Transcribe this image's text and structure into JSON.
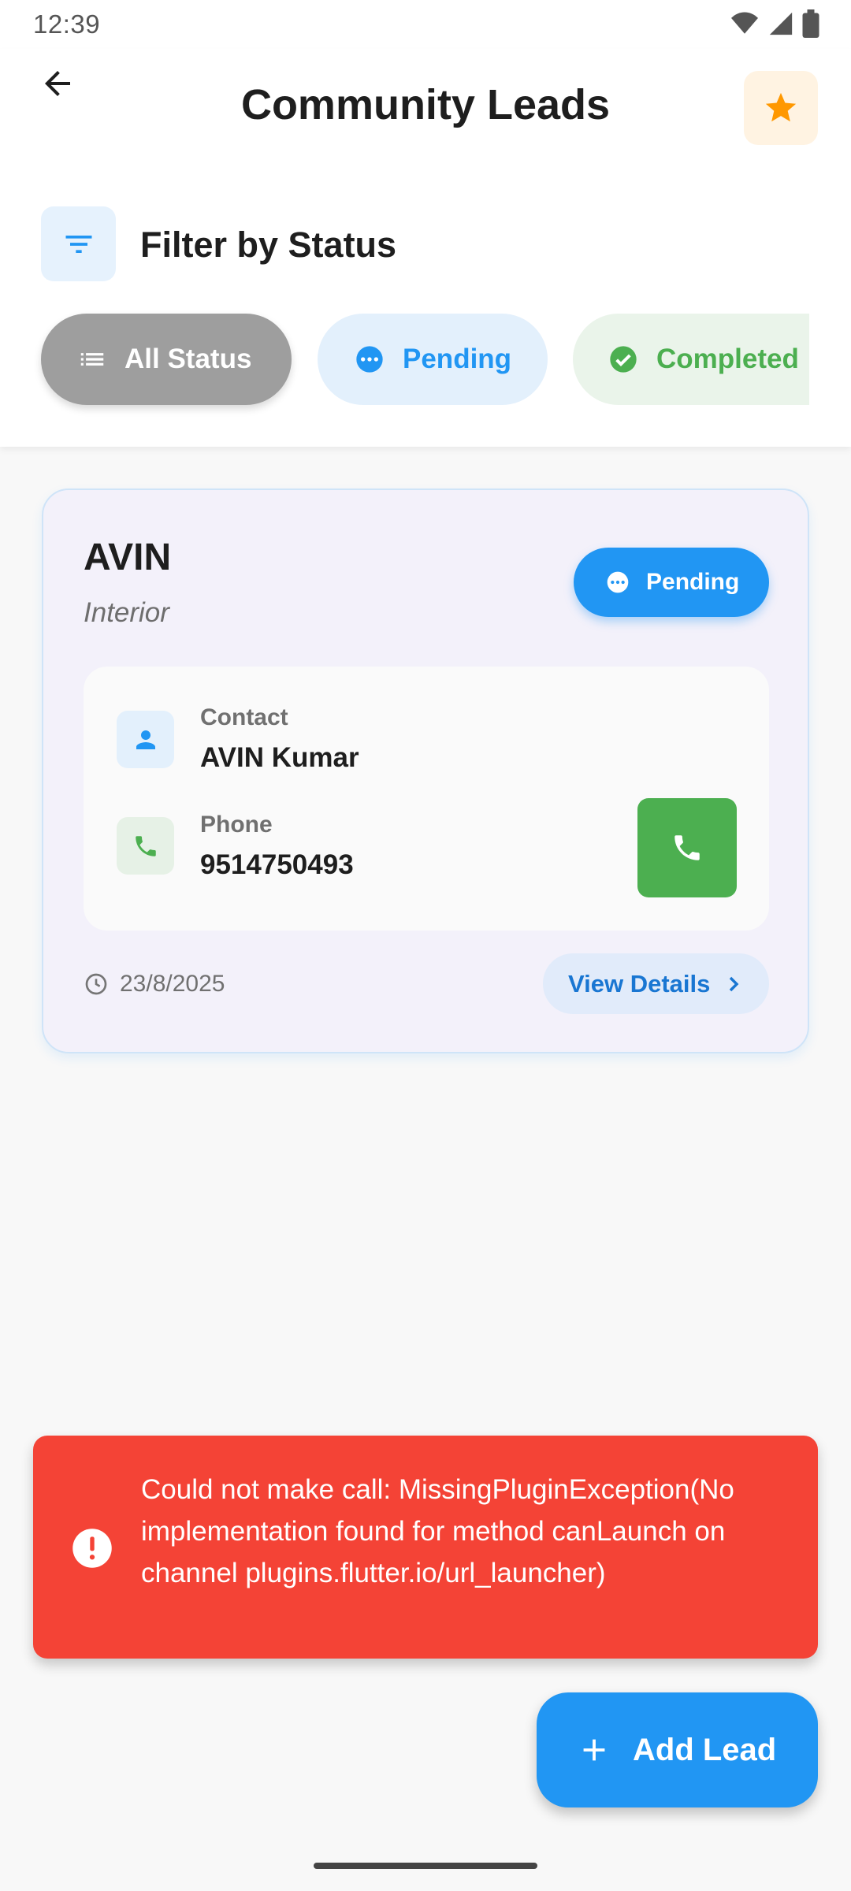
{
  "status_bar": {
    "time": "12:39",
    "icons": [
      "wifi-icon",
      "signal-icon",
      "battery-icon"
    ]
  },
  "header": {
    "title": "Community Leads",
    "back_icon": "arrow-back-icon",
    "action_icon": "star-icon"
  },
  "filter": {
    "title": "Filter by Status",
    "chips": [
      {
        "label": "All Status",
        "icon": "list-icon",
        "selected": true
      },
      {
        "label": "Pending",
        "icon": "more-circle-icon",
        "selected": false
      },
      {
        "label": "Completed",
        "icon": "check-circle-icon",
        "selected": false
      }
    ]
  },
  "lead_card": {
    "name": "AVIN",
    "type": "Interior",
    "status_badge": "Pending",
    "contact_label": "Contact",
    "contact_value": "AVIN Kumar",
    "phone_label": "Phone",
    "phone_value": "9514750493",
    "date": "23/8/2025",
    "view_details": "View Details"
  },
  "snackbar": {
    "message": "Could not make call: MissingPluginException(No implementation found for method canLaunch on channel plugins.flutter.io/url_launcher)"
  },
  "fab": {
    "label": "Add Lead"
  },
  "colors": {
    "primary": "#2196f3",
    "success": "#4caf50",
    "error": "#f44336",
    "accent": "#ff9800"
  }
}
